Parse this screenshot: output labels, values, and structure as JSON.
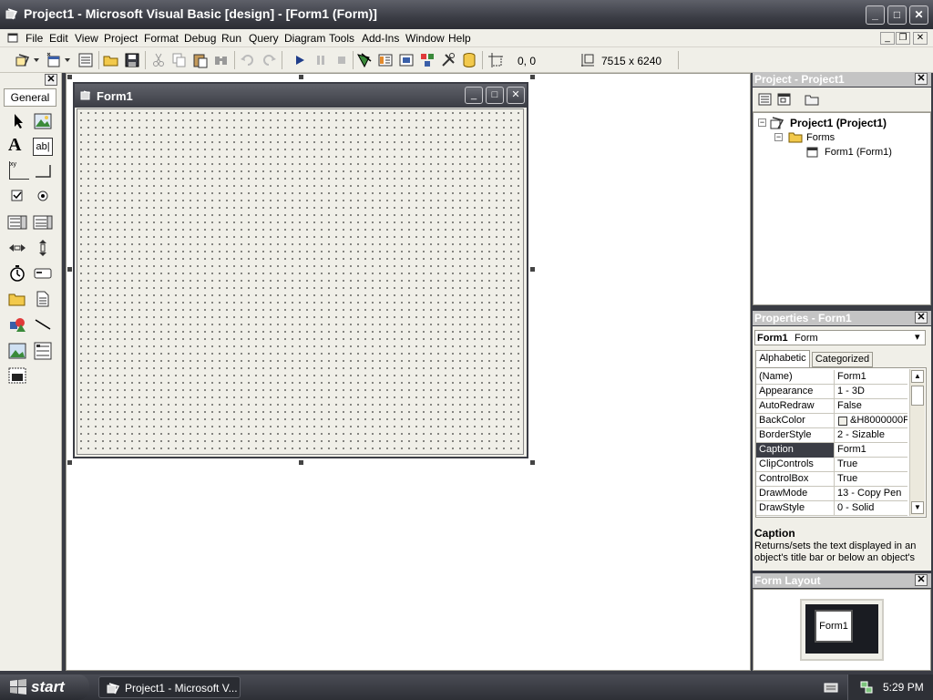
{
  "app": {
    "title": "Project1 - Microsoft Visual Basic [design] - [Form1 (Form)]"
  },
  "window_controls": {
    "minimize": "_",
    "maximize": "□",
    "close": "✕"
  },
  "menu": {
    "items": [
      "File",
      "Edit",
      "View",
      "Project",
      "Format",
      "Debug",
      "Run",
      "Query",
      "Diagram",
      "Tools",
      "Add-Ins",
      "Window",
      "Help"
    ]
  },
  "mdi_controls": {
    "minimize": "_",
    "restore": "❐",
    "close": "✕"
  },
  "toolbar": {
    "position": "0, 0",
    "size": "7515 x 6240"
  },
  "toolbox": {
    "close": "✕",
    "tab_label": "General",
    "tool_text_label": "A",
    "tool_textbox": "ab|",
    "tool_frame": "xy"
  },
  "form1": {
    "caption": "Form1",
    "min": "_",
    "max": "□",
    "close": "✕"
  },
  "project_explorer": {
    "title": "Project - Project1",
    "close": "✕",
    "tree": {
      "root": "Project1 (Project1)",
      "folder": "Forms",
      "item": "Form1 (Form1)"
    },
    "expanders": {
      "root": "−",
      "folder": "−"
    }
  },
  "properties": {
    "title": "Properties - Form1",
    "close": "✕",
    "object_name": "Form1",
    "object_type": "Form",
    "dropdown_arrow": "▾",
    "tabs": [
      "Alphabetic",
      "Categorized"
    ],
    "rows": [
      {
        "name": "(Name)",
        "value": "Form1"
      },
      {
        "name": "Appearance",
        "value": "1 - 3D"
      },
      {
        "name": "AutoRedraw",
        "value": "False"
      },
      {
        "name": "BackColor",
        "value": "&H8000000F"
      },
      {
        "name": "BorderStyle",
        "value": "2 - Sizable"
      },
      {
        "name": "Caption",
        "value": "Form1"
      },
      {
        "name": "ClipControls",
        "value": "True"
      },
      {
        "name": "ControlBox",
        "value": "True"
      },
      {
        "name": "DrawMode",
        "value": "13 - Copy Pen"
      },
      {
        "name": "DrawStyle",
        "value": "0 - Solid"
      }
    ],
    "selected_row": 5,
    "scroll_up": "▲",
    "scroll_down": "▼",
    "description_title": "Caption",
    "description_text": "Returns/sets the text displayed in an object's title bar or below an object's"
  },
  "form_layout": {
    "title": "Form Layout",
    "close": "✕",
    "preview_label": "Form1"
  },
  "taskbar": {
    "start_label": "start",
    "task_label": "Project1 - Microsoft V...",
    "clock": "5:29 PM"
  },
  "colors": {
    "selection": "#3b3d45",
    "panel_header": "#c4c4c4",
    "accent": "#3b3d45"
  }
}
